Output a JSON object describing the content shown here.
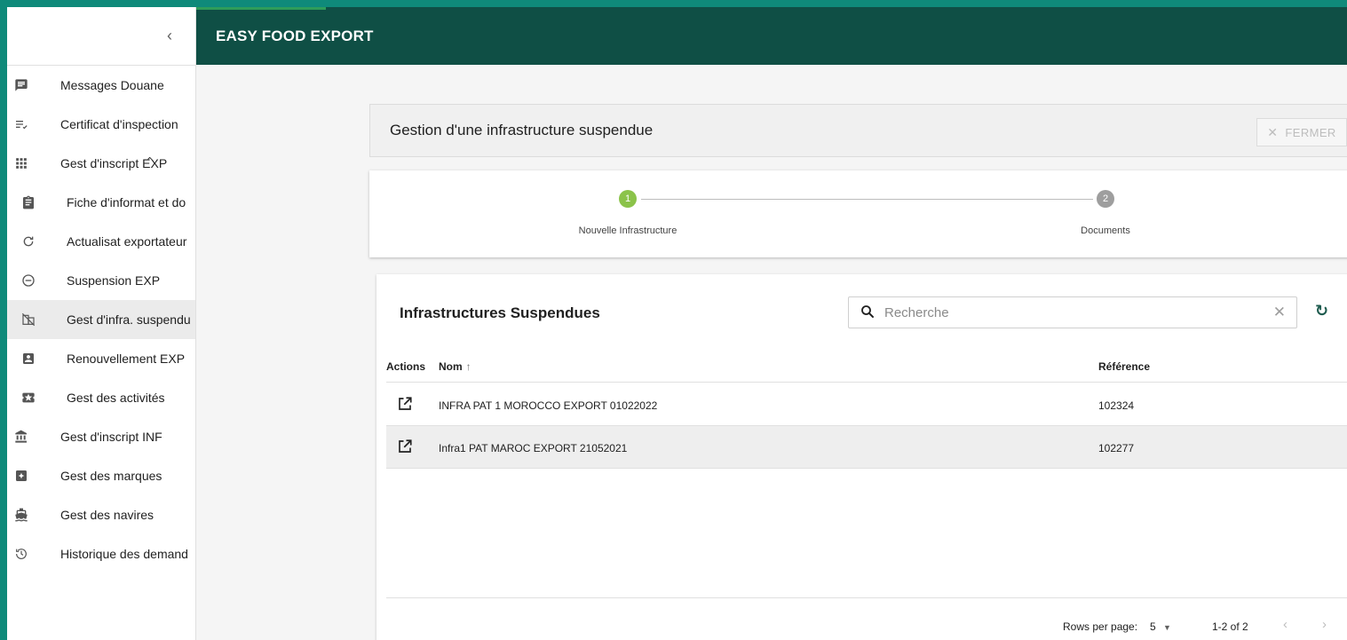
{
  "app": {
    "title": "EASY FOOD EXPORT"
  },
  "sidebar": {
    "collapse_glyph": "‹",
    "items": [
      {
        "label": "Messages Douane",
        "icon": "message-icon"
      },
      {
        "label": "Certificat d'inspection",
        "icon": "checklist-icon"
      },
      {
        "label": "Gest d'inscript EXP",
        "icon": "grid-icon",
        "expanded": true
      },
      {
        "label": "Fiche d'informat et do",
        "icon": "clipboard-icon"
      },
      {
        "label": "Actualisat exportateur",
        "icon": "refresh-icon"
      },
      {
        "label": "Suspension EXP",
        "icon": "minus-circle-icon"
      },
      {
        "label": "Gest d'infra. suspendu",
        "icon": "domain-disabled-icon",
        "active": true
      },
      {
        "label": "Renouvellement EXP",
        "icon": "account-box-icon"
      },
      {
        "label": "Gest des activités",
        "icon": "ticket-icon"
      },
      {
        "label": "Gest d'inscript INF",
        "icon": "bank-icon"
      },
      {
        "label": "Gest des marques",
        "icon": "sparkle-box-icon"
      },
      {
        "label": "Gest des navires",
        "icon": "ship-icon"
      },
      {
        "label": "Historique des demand",
        "icon": "history-icon"
      }
    ]
  },
  "page": {
    "title": "Gestion d'une infrastructure suspendue",
    "close_label": "FERMER"
  },
  "stepper": {
    "steps": [
      {
        "number": "1",
        "label": "Nouvelle Infrastructure",
        "color": "#8bc34a"
      },
      {
        "number": "2",
        "label": "Documents",
        "color": "#9e9e9e"
      }
    ]
  },
  "table": {
    "title": "Infrastructures Suspendues",
    "search_placeholder": "Recherche",
    "columns": {
      "actions": "Actions",
      "nom": "Nom",
      "reference": "Référence"
    },
    "sort_glyph": "↑",
    "rows": [
      {
        "nom": "INFRA PAT 1 MOROCCO EXPORT 01022022",
        "reference": "102324"
      },
      {
        "nom": "Infra1 PAT MAROC EXPORT 21052021",
        "reference": "102277"
      }
    ],
    "footer": {
      "rows_per_page_label": "Rows per page:",
      "rows_per_page_value": "5",
      "range": "1-2 of 2"
    }
  },
  "colors": {
    "brand": "#0f4f45",
    "accent": "#0f8a7a",
    "step_active": "#8bc34a",
    "refresh": "#1e5b4e"
  }
}
